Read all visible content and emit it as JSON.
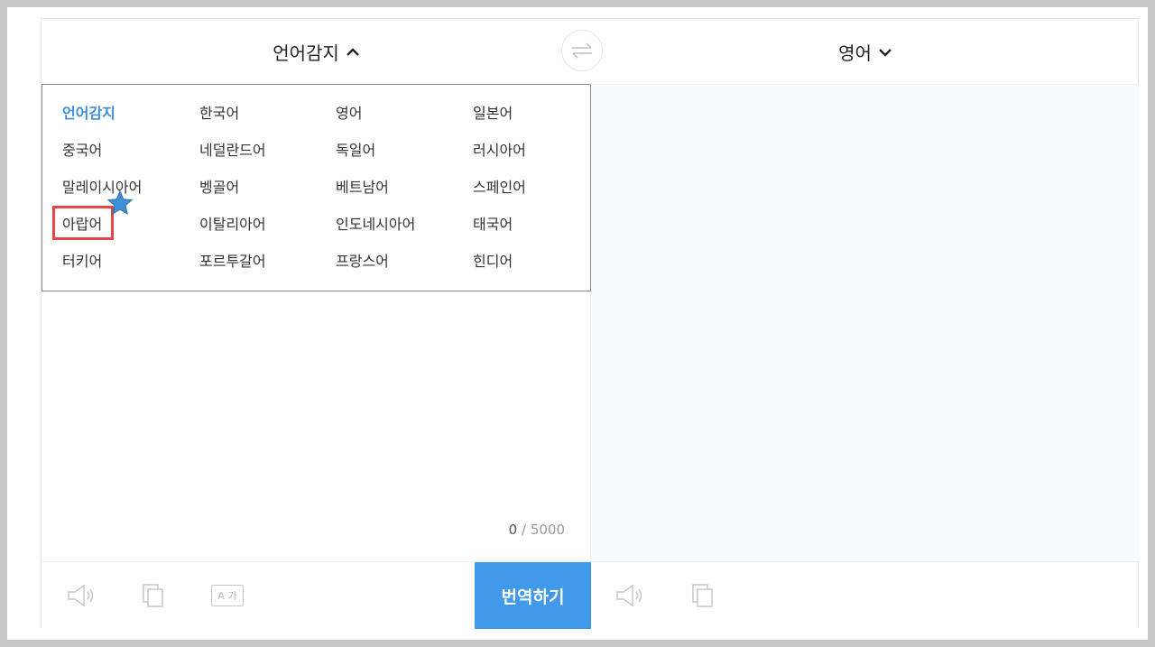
{
  "header": {
    "source_lang": "언어감지",
    "target_lang": "영어"
  },
  "dropdown": {
    "options": [
      [
        "언어감지",
        "한국어",
        "영어",
        "일본어"
      ],
      [
        "중국어",
        "네덜란드어",
        "독일어",
        "러시아어"
      ],
      [
        "말레이시아어",
        "벵골어",
        "베트남어",
        "스페인어"
      ],
      [
        "아랍어",
        "이탈리아어",
        "인도네시아어",
        "태국어"
      ],
      [
        "터키어",
        "포르투갈어",
        "프랑스어",
        "힌디어"
      ]
    ],
    "selected": "언어감지"
  },
  "counter": {
    "current": "0",
    "max": "/ 5000"
  },
  "footer": {
    "translate_label": "번역하기",
    "font_icon_text": "A 가"
  },
  "colors": {
    "accent": "#4199e9",
    "highlight": "#e84545",
    "star": "#3f8fd6"
  }
}
